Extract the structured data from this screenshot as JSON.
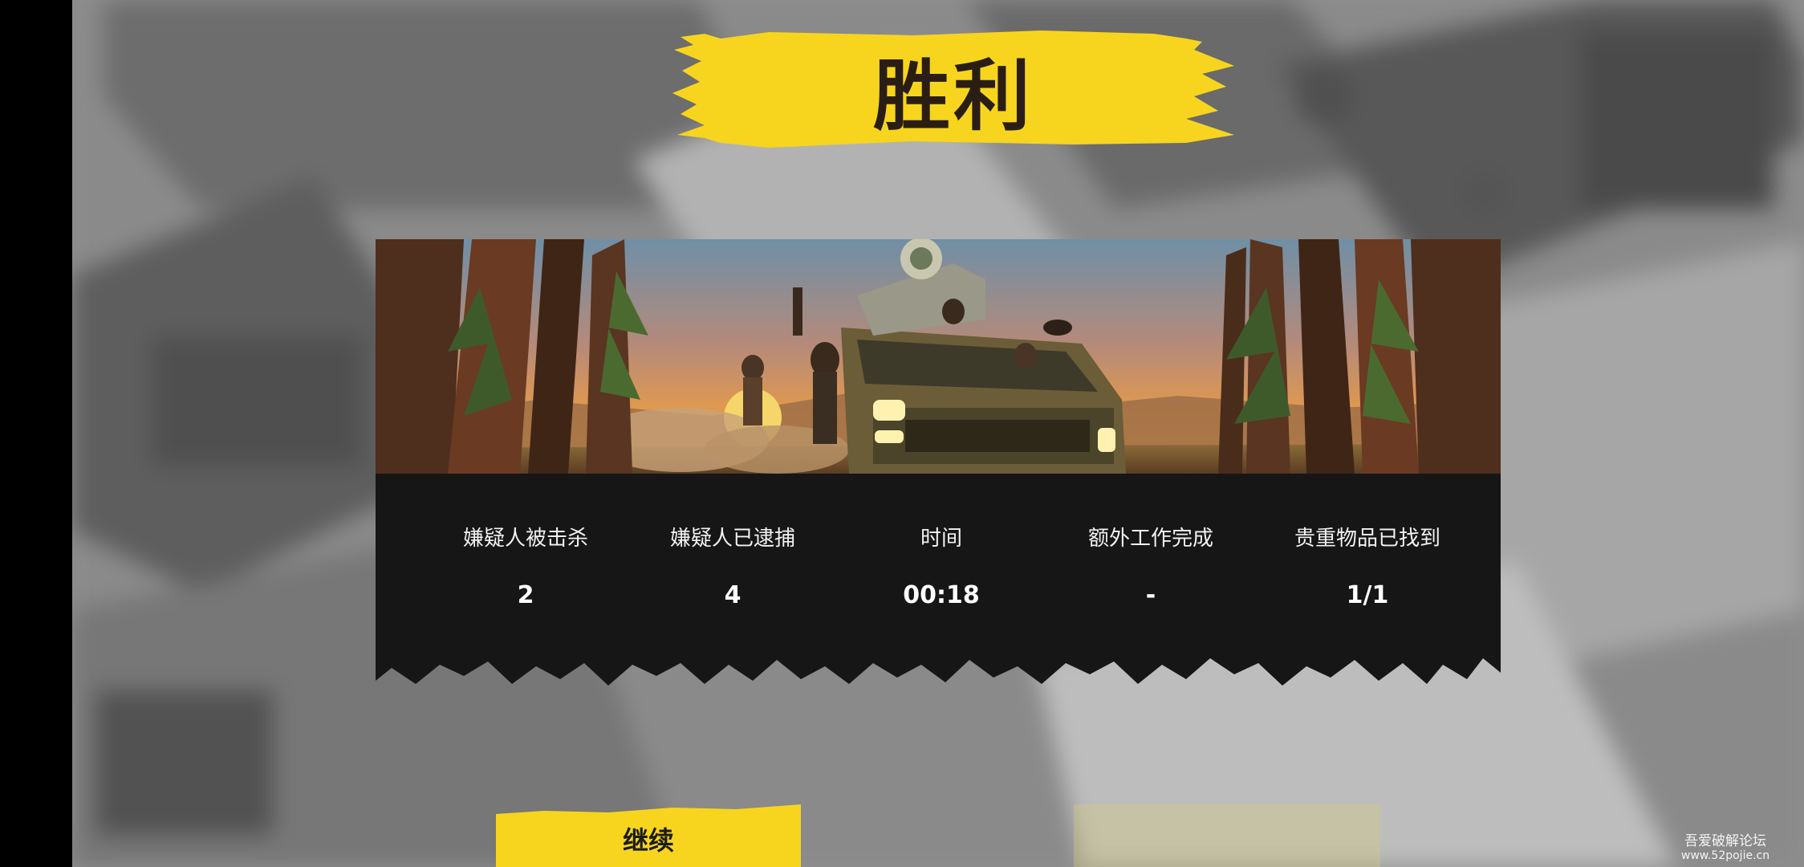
{
  "title": "胜利",
  "stats": [
    {
      "label": "嫌疑人被击杀",
      "value": "2"
    },
    {
      "label": "嫌疑人已逮捕",
      "value": "4"
    },
    {
      "label": "时间",
      "value": "00:18"
    },
    {
      "label": "额外工作完成",
      "value": "-"
    },
    {
      "label": "贵重物品已找到",
      "value": "1/1"
    }
  ],
  "buttons": {
    "continue_label": "继续"
  },
  "watermark": {
    "line1": "吾爱破解论坛",
    "line2": "www.52pojie.cn"
  },
  "colors": {
    "banner_yellow": "#f7d51e",
    "panel_dark": "#161616",
    "background_grey": "#8e8e8e"
  }
}
